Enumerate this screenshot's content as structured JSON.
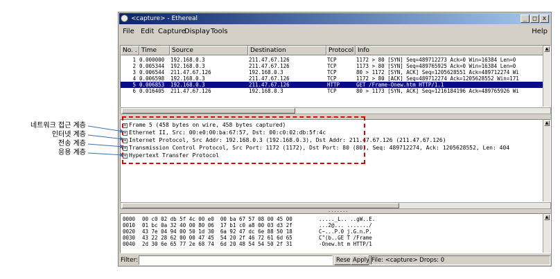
{
  "window": {
    "title": "<capture> - Ethereal",
    "controls": [
      "_",
      "□",
      "x"
    ]
  },
  "menu": {
    "items": [
      "File",
      "Edit",
      "Capture",
      "Display",
      "Tools"
    ],
    "help": "Help"
  },
  "packet_list": {
    "columns": [
      "No. .",
      "Time",
      "Source",
      "Destination",
      "Protocol",
      "Info"
    ],
    "rows": [
      {
        "no": "1",
        "time": "0.000000",
        "source": "192.168.0.3",
        "destination": "211.47.67.126",
        "protocol": "TCP",
        "info": "1172 > 80 [SYN] Seq=489712273 Ack=0 Win=16384 Len=0"
      },
      {
        "no": "2",
        "time": "0.005344",
        "source": "192.168.0.3",
        "destination": "211.47.67.126",
        "protocol": "TCP",
        "info": "1173 > 80 [SYN] Seq=489765925 Ack=0 Win=16384 Len=0"
      },
      {
        "no": "3",
        "time": "0.006544",
        "source": "211.47.67.126",
        "destination": "192.168.0.3",
        "protocol": "TCP",
        "info": "80 > 1172 [SYN, ACK] Seq=1205628551 Ack=489712274 Wi"
      },
      {
        "no": "4",
        "time": "0.006598",
        "source": "192.168.0.3",
        "destination": "211.47.67.126",
        "protocol": "TCP",
        "info": "1172 > 80 [ACK] Seq=489712274 Ack=1205628552 Win=171"
      },
      {
        "no": "5",
        "time": "0.006853",
        "source": "192.168.0.3",
        "destination": "211.47.67.126",
        "protocol": "HTTP",
        "info": "GET /Frame-Onew.htm HTTP/1.1"
      },
      {
        "no": "6",
        "time": "0.016405",
        "source": "211.47.67.126",
        "destination": "192.168.0.3",
        "protocol": "TCP",
        "info": "80 > 1173 [SYN, ACK] Seq=1216184196 Ack=489765926 Wi"
      }
    ],
    "selected_index": 4
  },
  "detail": {
    "lines": [
      "Frame 5 (458 bytes on wire, 458 bytes captured)",
      "Ethernet II, Src: 00:e0:00:ba:67:57, Dst: 00:c0:02:db:5f:4c",
      "Internet Protocol, Src Addr: 192.168.0.3 (192.168.0.3), Dst Addr: 211.47.67.126 (211.47.67.126)",
      "Transmission Control Protocol, Src Port: 1172 (1172), Dst Port: 80 (80), Seq: 489712274, Ack: 1205628552, Len: 404",
      "Hypertext Transfer Protocol"
    ],
    "expander": "+"
  },
  "hex": {
    "rows": [
      {
        "offset": "0000",
        "bytes": "00 c0 02 db 5f 4c 00 e0  00 ba 67 57 08 00 45 00",
        "ascii": "....._L.. ..gW..E."
      },
      {
        "offset": "0010",
        "bytes": "01 bc 0a 32 40 00 80 06  17 b1 c0 a8 00 03 d3 2f",
        "ascii": "...2@... ......./"
      },
      {
        "offset": "0020",
        "bytes": "43 7e 04 94 00 50 1d 30  6a 92 47 dc 6e 88 50 18",
        "ascii": "C~...P.0 j.G.n.P."
      },
      {
        "offset": "0030",
        "bytes": "43 22 28 62 00 00 47 45  54 20 2f 46 72 61 6d 65",
        "ascii": "C\"(b..GE T /Frame"
      },
      {
        "offset": "0040",
        "bytes": "2d 30 6e 65 77 2e 68 74  6d 20 48 54 54 50 2f 31",
        "ascii": "-Onew.ht m HTTP/1"
      }
    ]
  },
  "filter": {
    "label": "Filter:",
    "value": "",
    "reset": "Reset",
    "apply": "Apply",
    "status": "File: <capture>  Drops: 0"
  },
  "annotations": {
    "network_access": "네트워크 접근 계층",
    "internet": "인터넷 계층",
    "transport": "전송 계층",
    "application": "응용 계층",
    "highlight_color": "#e00000"
  },
  "colors": {
    "selected_row": "#0a0a8c",
    "titlebar": "#0a246a"
  }
}
